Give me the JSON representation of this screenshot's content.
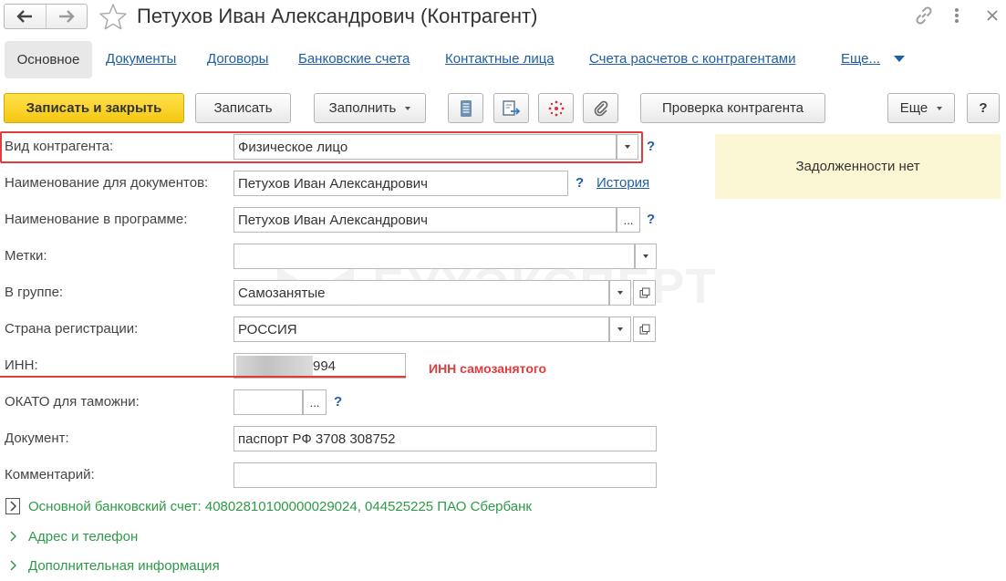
{
  "window": {
    "title": "Петухов Иван Александрович (Контрагент)",
    "icons": [
      "arrow-left-icon",
      "arrow-right-icon",
      "star-icon",
      "link-icon",
      "kebab-menu-icon",
      "close-icon"
    ]
  },
  "tabs": [
    {
      "label": "Основное",
      "active": true
    },
    {
      "label": "Документы"
    },
    {
      "label": "Договоры"
    },
    {
      "label": "Банковские счета"
    },
    {
      "label": "Контактные лица"
    },
    {
      "label": "Счета расчетов с контрагентами"
    },
    {
      "label": "Еще..."
    }
  ],
  "toolbar": {
    "save_close": "Записать и закрыть",
    "save": "Записать",
    "fill": "Заполнить",
    "icon_buttons": [
      "report-icon",
      "exchange-icon",
      "structure-icon",
      "attachment-icon"
    ],
    "check": "Проверка контрагента",
    "more": "Еще",
    "help": "?"
  },
  "form": {
    "kind": {
      "label": "Вид контрагента:",
      "value": "Физическое лицо"
    },
    "doc_name": {
      "label": "Наименование для документов:",
      "value": "Петухов Иван Александрович",
      "history_link": "История"
    },
    "prog_name": {
      "label": "Наименование в программе:",
      "value": "Петухов Иван Александрович",
      "picker": "..."
    },
    "tags": {
      "label": "Метки:",
      "value": ""
    },
    "group": {
      "label": "В группе:",
      "value": "Самозанятые"
    },
    "country": {
      "label": "Страна регистрации:",
      "value": "РОССИЯ"
    },
    "inn": {
      "label": "ИНН:",
      "value_visible": "994",
      "annotation": "ИНН самозанятого"
    },
    "okato": {
      "label": "ОКАТО для таможни:",
      "value": "",
      "picker": "..."
    },
    "document": {
      "label": "Документ:",
      "value": "паспорт РФ 3708 308752"
    },
    "comment": {
      "label": "Комментарий:",
      "value": ""
    },
    "help_mark": "?"
  },
  "debt_panel": {
    "text": "Задолженности нет",
    "background": "#fbf6d4"
  },
  "sections": [
    {
      "label": "Основной банковский счет: 40802810100000029024, 044525225 ПАО Сбербанк"
    },
    {
      "label": "Адрес и телефон"
    },
    {
      "label": "Дополнительная информация"
    }
  ],
  "watermark": {
    "text": "БУХЭКСПЕРТ"
  },
  "colors": {
    "primary_button": "#f4c813",
    "link": "#1f5fa8",
    "group_link": "#2e9a48",
    "highlight": "#e23b3b"
  }
}
